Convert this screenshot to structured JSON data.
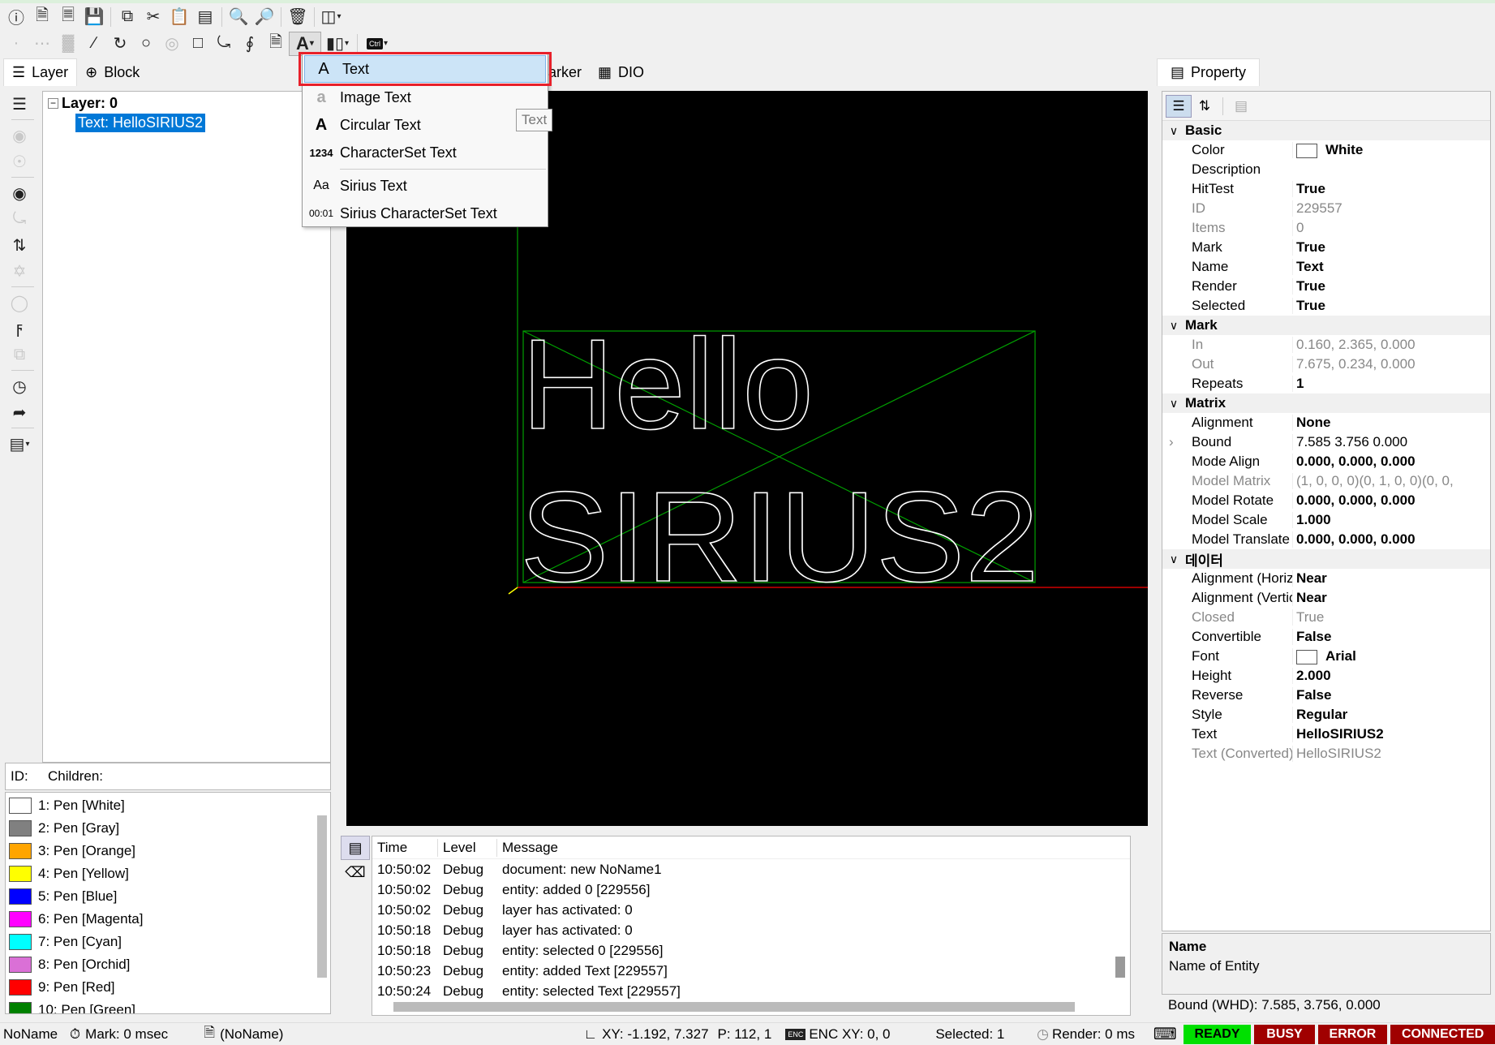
{
  "toolbar": {
    "row1_icons": [
      "info-icon",
      "new-document-icon",
      "open-document-icon",
      "save-icon",
      "copy-icon",
      "cut-icon",
      "paste-icon",
      "paste-array-icon",
      "zoom-in-icon",
      "zoom-out-icon",
      "delete-icon",
      "align-icon"
    ],
    "row2_icons": [
      "point-icon",
      "points-icon",
      "raster-icon",
      "line-icon",
      "arc-icon",
      "circle-icon",
      "trepan-icon",
      "rectangle-icon",
      "polyline-icon",
      "spiral-icon",
      "image-icon",
      "text-tool-icon",
      "barcode-icon",
      "control-icon"
    ]
  },
  "left_tabs": [
    {
      "label": "Layer"
    },
    {
      "label": "Block"
    }
  ],
  "center_tabs": [
    {
      "label": "arker"
    },
    {
      "label": "DIO"
    }
  ],
  "right_tabs": [
    {
      "label": "Property"
    }
  ],
  "tree": {
    "layer": "Layer: 0",
    "child": "Text: HelloSIRIUS2"
  },
  "info_header": {
    "id": "ID:",
    "children": "Children:"
  },
  "pens": [
    {
      "label": "1: Pen [White]",
      "color": "#ffffff"
    },
    {
      "label": "2: Pen [Gray]",
      "color": "#808080"
    },
    {
      "label": "3: Pen [Orange]",
      "color": "#ffa500"
    },
    {
      "label": "4: Pen [Yellow]",
      "color": "#ffff00"
    },
    {
      "label": "5: Pen [Blue]",
      "color": "#0000ff"
    },
    {
      "label": "6: Pen [Magenta]",
      "color": "#ff00ff"
    },
    {
      "label": "7: Pen [Cyan]",
      "color": "#00ffff"
    },
    {
      "label": "8: Pen [Orchid]",
      "color": "#da70d6"
    },
    {
      "label": "9: Pen [Red]",
      "color": "#ff0000"
    },
    {
      "label": "10: Pen [Green]",
      "color": "#008000"
    }
  ],
  "menu": {
    "items": [
      {
        "label": "Text",
        "icon": "A"
      },
      {
        "label": "Image Text",
        "icon": "a"
      },
      {
        "label": "Circular Text",
        "icon": "A"
      },
      {
        "label": "CharacterSet Text",
        "icon": "1234"
      },
      {
        "label": "Sirius Text",
        "icon": "Aa"
      },
      {
        "label": "Sirius CharacterSet Text",
        "icon": "00:01"
      }
    ],
    "tooltip": "Text"
  },
  "canvas": {
    "line1": "Hello",
    "line2": "SIRIUS2"
  },
  "log": {
    "headers": [
      "Time",
      "Level",
      "Message"
    ],
    "rows": [
      [
        "10:50:02",
        "Debug",
        "document: new NoName1"
      ],
      [
        "10:50:02",
        "Debug",
        "entity: added 0 [229556]"
      ],
      [
        "10:50:02",
        "Debug",
        "layer has activated: 0"
      ],
      [
        "10:50:18",
        "Debug",
        "layer has activated: 0"
      ],
      [
        "10:50:18",
        "Debug",
        "entity: selected 0 [229556]"
      ],
      [
        "10:50:23",
        "Debug",
        "entity: added Text [229557]"
      ],
      [
        "10:50:24",
        "Debug",
        "entity: selected Text [229557]"
      ]
    ]
  },
  "props": {
    "cat_basic": "Basic",
    "color_k": "Color",
    "color_v": "White",
    "desc_k": "Description",
    "desc_v": "",
    "hit_k": "HitTest",
    "hit_v": "True",
    "id_k": "ID",
    "id_v": "229557",
    "items_k": "Items",
    "items_v": "0",
    "mark_k": "Mark",
    "mark_v": "True",
    "name_k": "Name",
    "name_v": "Text",
    "render_k": "Render",
    "render_v": "True",
    "sel_k": "Selected",
    "sel_v": "True",
    "cat_mark": "Mark",
    "in_k": "In",
    "in_v": "0.160, 2.365, 0.000",
    "out_k": "Out",
    "out_v": "7.675, 0.234, 0.000",
    "rep_k": "Repeats",
    "rep_v": "1",
    "cat_matrix": "Matrix",
    "align_k": "Alignment",
    "align_v": "None",
    "bound_k": "Bound",
    "bound_v": "7.585 3.756 0.000",
    "malign_k": "Mode Align",
    "malign_v": "0.000, 0.000, 0.000",
    "mmat_k": "Model Matrix",
    "mmat_v": "(1, 0, 0, 0)(0, 1, 0, 0)(0, 0,",
    "mrot_k": "Model Rotate",
    "mrot_v": "0.000, 0.000, 0.000",
    "mscale_k": "Model Scale",
    "mscale_v": "1.000",
    "mtrans_k": "Model Translate",
    "mtrans_v": "0.000, 0.000, 0.000",
    "cat_data": "데이터",
    "ah_k": "Alignment (Horizontal)",
    "ah_v": "Near",
    "av_k": "Alignment (Vertical)",
    "av_v": "Near",
    "closed_k": "Closed",
    "closed_v": "True",
    "conv_k": "Convertible",
    "conv_v": "False",
    "font_k": "Font",
    "font_v": "Arial",
    "height_k": "Height",
    "height_v": "2.000",
    "rev_k": "Reverse",
    "rev_v": "False",
    "style_k": "Style",
    "style_v": "Regular",
    "text_k": "Text",
    "text_v": "HelloSIRIUS2",
    "textc_k": "Text (Converted)",
    "textc_v": "HelloSIRIUS2"
  },
  "desc": {
    "title": "Name",
    "body": "Name of Entity"
  },
  "bound_info": "Bound (WHD): 7.585, 3.756, 0.000",
  "status": {
    "doc": "NoName",
    "mark": "Mark: 0 msec",
    "file": "(NoName)",
    "xy": "XY: -1.192, 7.327",
    "p": "P: 112, 1",
    "enc": "ENC XY: 0, 0",
    "selected": "Selected: 1",
    "render": "Render: 0 ms",
    "ready": "READY",
    "busy": "BUSY",
    "error": "ERROR",
    "connected": "CONNECTED",
    "colors": {
      "ready": "#00e000",
      "busy": "#a00000",
      "error": "#a00000",
      "connected": "#a00000"
    }
  }
}
